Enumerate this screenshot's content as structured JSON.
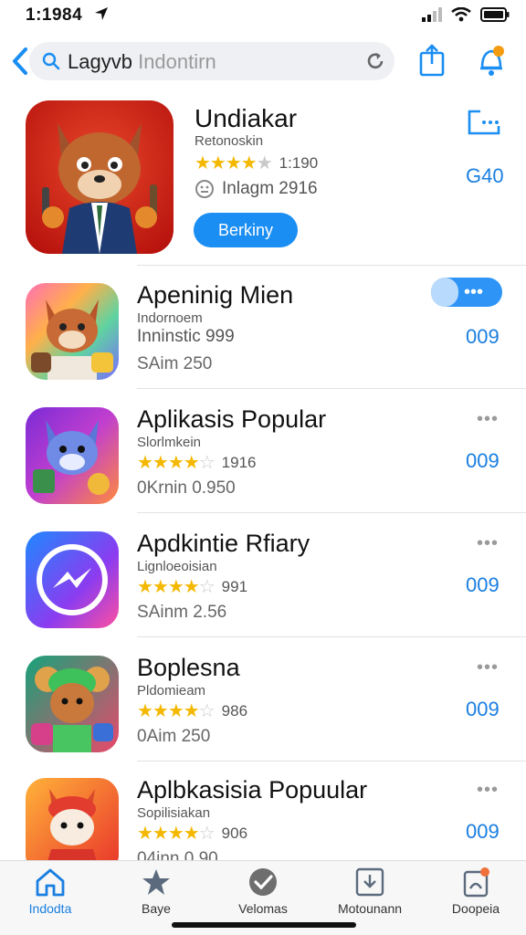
{
  "status_bar": {
    "time": "1:1984"
  },
  "nav": {
    "search_query": "Lagyvb",
    "search_hint": "Indontirn"
  },
  "featured": {
    "title": "Undiakar",
    "subtitle": "Retonoskin",
    "rating_value": "1:190",
    "rating_stars": 4.5,
    "reviews": "Inlagm 2916",
    "button_label": "Berkiny",
    "side_value": "G40"
  },
  "apps": [
    {
      "title": "Apeninig Mien",
      "subtitle": "Indornoem",
      "line": "Inninstic 999",
      "meta": "SAim 250",
      "value": "009",
      "stars": 0,
      "action": "toggle"
    },
    {
      "title": "Aplikasis Popular",
      "subtitle": "Slorlmkein",
      "rating_value": "1916",
      "meta": "0Krnin 0.950",
      "value": "009",
      "stars": 4,
      "action": "more"
    },
    {
      "title": "Apdkintie Rfiary",
      "subtitle": "Lignloeoisian",
      "rating_value": "991",
      "meta": "SAinm 2.56",
      "value": "009",
      "stars": 4,
      "action": "more"
    },
    {
      "title": "Boplesna",
      "subtitle": "Pldomieam",
      "rating_value": "986",
      "meta": "0Aim 250",
      "value": "009",
      "stars": 4,
      "action": "more"
    },
    {
      "title": "Aplbkasisia Popuular",
      "subtitle": "Sopilisiakan",
      "rating_value": "906",
      "meta": "04inn 0.90",
      "value": "009",
      "stars": 4,
      "action": "more"
    }
  ],
  "more_glyph": "•••",
  "tabs": [
    {
      "label": "Indodta",
      "icon": "home-icon",
      "active": true
    },
    {
      "label": "Baye",
      "icon": "star-icon",
      "active": false
    },
    {
      "label": "Velomas",
      "icon": "checkmark-icon",
      "active": false
    },
    {
      "label": "Motounann",
      "icon": "download-icon",
      "active": false
    },
    {
      "label": "Doopeia",
      "icon": "profile-icon",
      "active": false
    }
  ],
  "colors": {
    "accent": "#1a8ef2",
    "star": "#f5b800",
    "link_number": "#1a7fe0"
  }
}
